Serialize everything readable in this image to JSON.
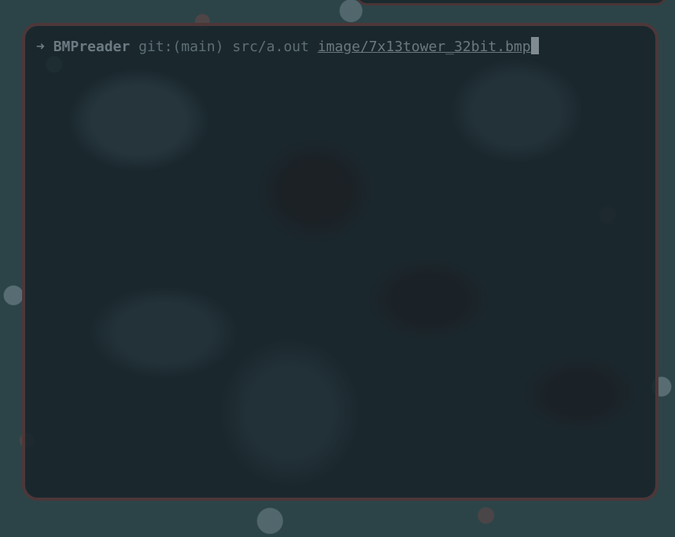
{
  "terminal": {
    "prompt_arrow": "➜",
    "directory": "BMPreader",
    "git_info": "git:(main)",
    "command": "src/a.out",
    "argument": "image/7x13tower_32bit.bmp"
  }
}
